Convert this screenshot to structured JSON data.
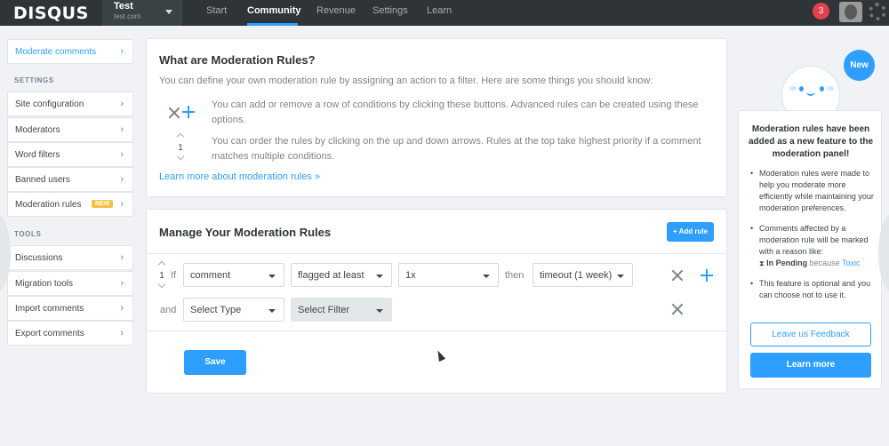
{
  "topbar": {
    "logo": "DISQUS",
    "site_name": "Test",
    "site_url": "test.com",
    "tabs": [
      {
        "label": "Start",
        "active": false
      },
      {
        "label": "Community",
        "active": true
      },
      {
        "label": "Revenue",
        "active": false
      },
      {
        "label": "Settings",
        "active": false
      },
      {
        "label": "Learn",
        "active": false
      }
    ],
    "notification_count": "3"
  },
  "sidebar": {
    "top_item": "Moderate comments",
    "settings_header": "SETTINGS",
    "settings_items": [
      "Site configuration",
      "Moderators",
      "Word filters",
      "Banned users",
      "Moderation rules"
    ],
    "new_tag": "NEW",
    "tools_header": "TOOLS",
    "tools_items": [
      "Discussions",
      "Migration tools",
      "Import comments",
      "Export comments"
    ]
  },
  "info_card": {
    "title": "What are Moderation Rules?",
    "intro": "You can define your own moderation rule by assigning an action to a filter. Here are some things you should know:",
    "tip1": "You can add or remove a row of conditions by clicking these buttons. Advanced rules can be created using these options.",
    "tip2": "You can order the rules by clicking on the up and down arrows. Rules at the top take highest priority if a comment matches multiple conditions.",
    "order_example": "1",
    "learn_link": "Learn more about moderation rules »"
  },
  "manage_card": {
    "title": "Manage Your Moderation Rules",
    "add_rule": "+ Add rule",
    "rule1": {
      "order": "1",
      "if_word": "If",
      "subject": "comment",
      "condition": "flagged at least",
      "count": "1x",
      "then_word": "then",
      "action": "timeout (1 week)"
    },
    "rule2": {
      "and_word": "and",
      "type": "Select Type",
      "filter": "Select Filter"
    },
    "save": "Save"
  },
  "side_panel": {
    "new_bubble": "New",
    "heading": "Moderation rules have been added as a new feature to the moderation panel!",
    "bullet1": "Moderation rules were made to help you moderate more efficiently while maintaining your moderation preferences.",
    "bullet2_text": "Comments affected by a moderation rule will be marked with a reason like:",
    "bullet2_status": "In Pending",
    "bullet2_because": "because",
    "bullet2_reason": "Toxic",
    "bullet3": "This feature is optional and you can choose not to use it.",
    "feedback_button": "Leave us Feedback",
    "learn_more_button": "Learn more"
  },
  "colors": {
    "accent": "#2e9fff",
    "topbar": "#2e3438",
    "badge": "#e0424b",
    "new_tag": "#f5c144"
  }
}
